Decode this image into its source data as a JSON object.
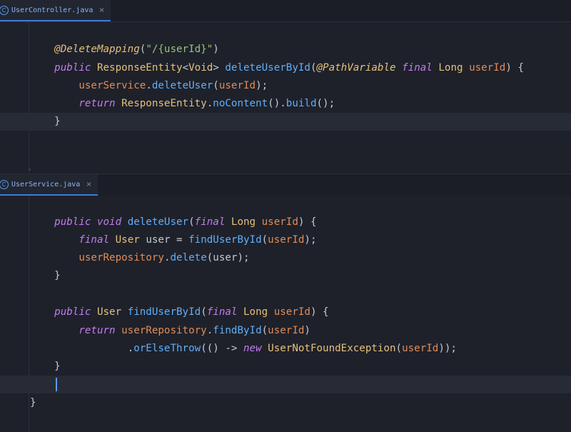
{
  "tabs": {
    "top": {
      "icon": "C",
      "name": "UserController.java",
      "close": "×"
    },
    "bottom": {
      "icon": "C",
      "name": "UserService.java",
      "close": "×"
    }
  },
  "controller": {
    "l1": {
      "annotation": "@DeleteMapping",
      "open": "(",
      "path": "\"/{userId}\"",
      "close": ")"
    },
    "l2": {
      "kw_public": "public",
      "sp1": " ",
      "type": "ResponseEntity",
      "generic_open": "<",
      "generic_type": "Void",
      "generic_close": ">",
      "sp2": " ",
      "method": "deleteUserById",
      "paren_open": "(",
      "path_var": "@PathVariable",
      "sp3": " ",
      "kw_final": "final",
      "sp4": " ",
      "param_type": "Long",
      "sp5": " ",
      "param": "userId",
      "tail": ") {"
    },
    "l3": {
      "field": "userService",
      "dot": ".",
      "call": "deleteUser",
      "open": "(",
      "arg": "userId",
      "close": ");"
    },
    "l4": {
      "kw_return": "return",
      "sp": " ",
      "type": "ResponseEntity",
      "dot1": ".",
      "call1": "noContent",
      "mid": "().",
      "call2": "build",
      "tail": "();"
    },
    "l5": {
      "brace": "}"
    }
  },
  "service": {
    "l1": {
      "kw_public": "public",
      "sp1": " ",
      "kw_void": "void",
      "sp2": " ",
      "method": "deleteUser",
      "open": "(",
      "kw_final": "final",
      "sp3": " ",
      "type": "Long",
      "sp4": " ",
      "param": "userId",
      "tail": ") {"
    },
    "l2": {
      "kw_final": "final",
      "sp1": " ",
      "type": "User",
      "mid": " user = ",
      "call": "findUserById",
      "open": "(",
      "arg": "userId",
      "close": ");"
    },
    "l3": {
      "field": "userRepository",
      "dot": ".",
      "call": "delete",
      "tail": "(user);"
    },
    "l4": {
      "brace": "}"
    },
    "l5": {
      "kw_public": "public",
      "sp1": " ",
      "type": "User",
      "sp2": " ",
      "method": "findUserById",
      "open": "(",
      "kw_final": "final",
      "sp3": " ",
      "param_type": "Long",
      "sp4": " ",
      "param": "userId",
      "tail": ") {"
    },
    "l6": {
      "kw_return": "return",
      "sp": " ",
      "field": "userRepository",
      "dot": ".",
      "call": "findById",
      "open": "(",
      "arg": "userId",
      "close": ")"
    },
    "l7": {
      "dot": ".",
      "call": "orElseThrow",
      "mid": "(() -> ",
      "kw_new": "new",
      "sp": " ",
      "type": "UserNotFoundException",
      "open": "(",
      "arg": "userId",
      "close": "));"
    },
    "l8": {
      "brace": "}"
    },
    "l9": {
      "brace": "}"
    }
  }
}
